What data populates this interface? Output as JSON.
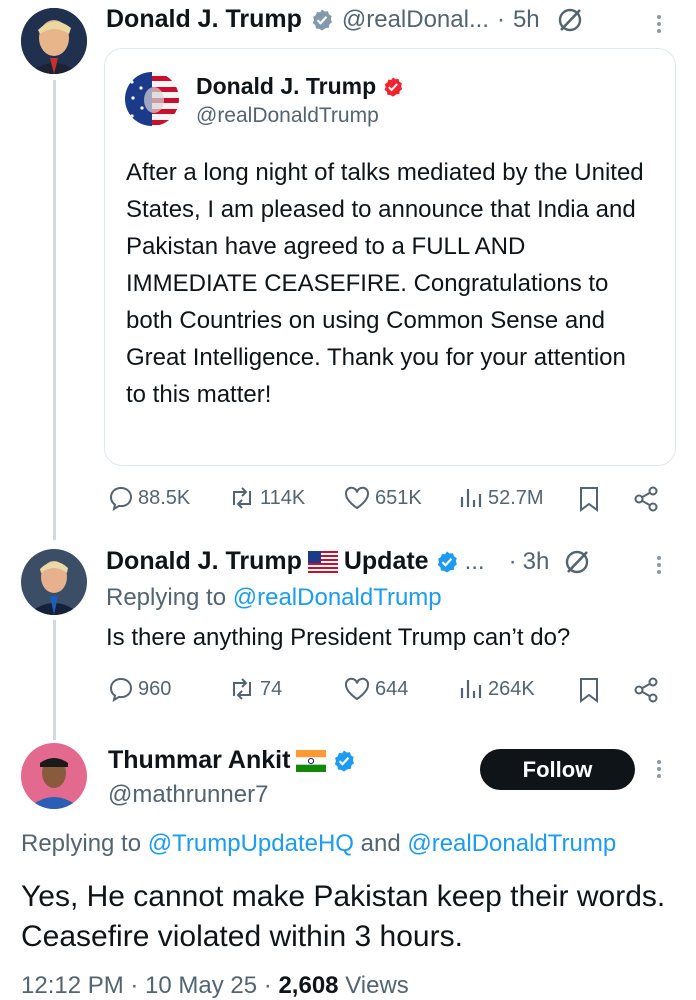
{
  "tweet1": {
    "name": "Donald J. Trump",
    "handle": "@realDonal...",
    "time": "5h",
    "quote": {
      "name": "Donald J. Trump",
      "handle": "@realDonaldTrump",
      "text": "After a long night of talks mediated by the United States, I am pleased to announce that India and Pakistan have agreed to a FULL AND IMMEDIATE CEASEFIRE. Congratulations to both Countries on using Common Sense and Great Intelligence. Thank you for your attention to this matter!"
    },
    "stats": {
      "replies": "88.5K",
      "retweets": "114K",
      "likes": "651K",
      "views": "52.7M"
    }
  },
  "tweet2": {
    "name": "Donald J. Trump",
    "name_suffix": "Update",
    "handle": "...",
    "time": "3h",
    "replying_prefix": "Replying to",
    "replying_to": "@realDonaldTrump",
    "text": "Is there anything President Trump can’t do?",
    "stats": {
      "replies": "960",
      "retweets": "74",
      "likes": "644",
      "views": "264K"
    }
  },
  "tweet3": {
    "name": "Thummar Ankit",
    "handle": "@mathrunner7",
    "follow_label": "Follow",
    "replying_prefix": "Replying to",
    "replying_to_1": "@TrumpUpdateHQ",
    "replying_and": "and",
    "replying_to_2": "@realDonaldTrump",
    "text": "Yes, He cannot make Pakistan keep their words. Ceasefire violated within 3 hours.",
    "timestamp": "12:12 PM · 10 May 25 · ",
    "views_count": "2,608",
    "views_label": "Views"
  },
  "colors": {
    "accent": "#1d9bf0",
    "gray": "#536471",
    "verified": "#1d9bf0",
    "gold_verified": "#8899a6",
    "red_badge": "#f4212e"
  }
}
